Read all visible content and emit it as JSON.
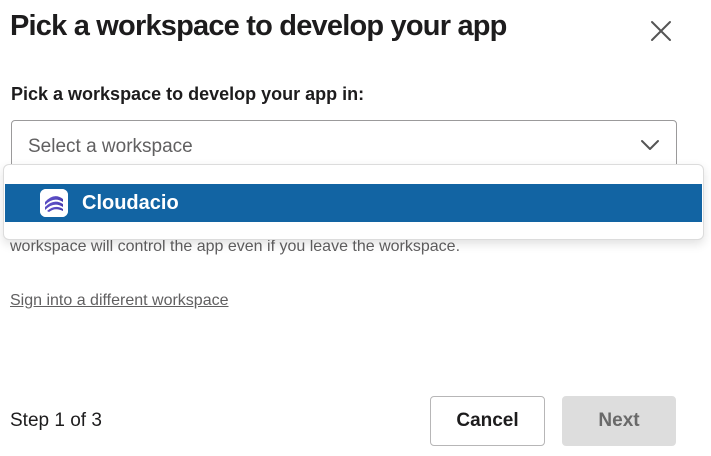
{
  "modal": {
    "title": "Pick a workspace to develop your app",
    "close_icon": "close-icon"
  },
  "workspace_field": {
    "label": "Pick a workspace to develop your app in:",
    "placeholder": "Select a workspace",
    "chevron_icon": "chevron-down-icon"
  },
  "dropdown": {
    "options": [
      {
        "name": "Cloudacio",
        "icon": "cloudacio-logo",
        "highlighted": true
      }
    ],
    "highlight_color": "#1264a3"
  },
  "help_text": "workspace will control the app even if you leave the workspace.",
  "sign_in_link": "Sign into a different workspace",
  "footer": {
    "step_text": "Step 1 of 3",
    "cancel_label": "Cancel",
    "next_label": "Next"
  }
}
